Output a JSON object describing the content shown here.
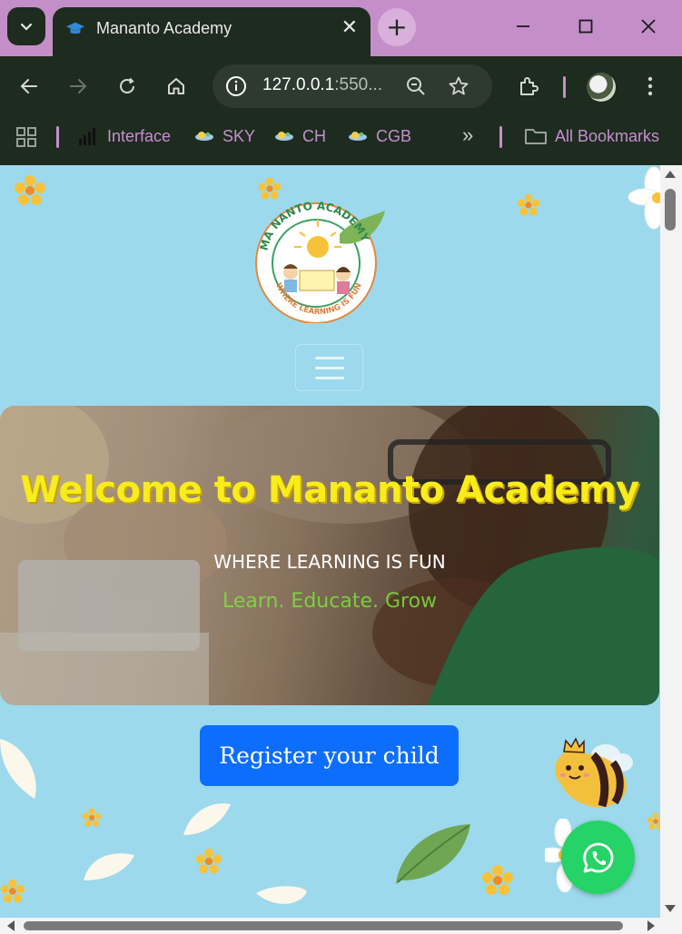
{
  "browser": {
    "tab": {
      "title": "Mananto Academy"
    },
    "new_tab_symbol": "+",
    "close_symbol": "✕",
    "address": {
      "host": "127.0.0.1",
      "rest": ":550..."
    },
    "bookmarks": [
      {
        "label": "Interface",
        "icon": "bar-chart-icon"
      },
      {
        "label": "SKY",
        "icon": "satellite-icon"
      },
      {
        "label": "CH",
        "icon": "satellite-icon"
      },
      {
        "label": "CGB",
        "icon": "satellite-icon"
      }
    ],
    "overflow_symbol": "»",
    "all_bookmarks": "All Bookmarks"
  },
  "site": {
    "logo": {
      "top_text": "MA NANTO ACADEMY",
      "bottom_text": "WHERE LEARNING IS FUN"
    },
    "hero": {
      "title": "Welcome to Mananto Academy",
      "subtitle": "WHERE LEARNING IS FUN",
      "tagline": "Learn. Educate. Grow"
    },
    "register_label": "Register your child",
    "colors": {
      "page_bg": "#9dd9ec",
      "hero_title": "#f8ec1b",
      "tagline": "#7ee03e",
      "button": "#0d6efd",
      "whatsapp": "#25d366",
      "browser_frame": "#c48fc8"
    }
  }
}
